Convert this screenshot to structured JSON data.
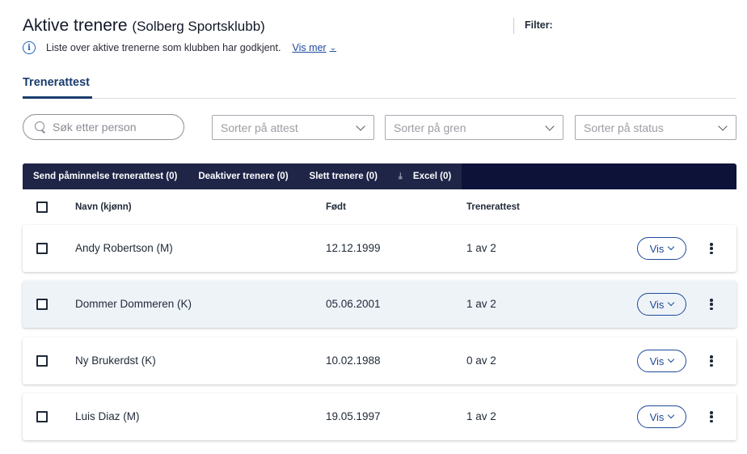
{
  "header": {
    "title": "Aktive trenere",
    "club": "(Solberg Sportsklubb)",
    "info_icon": "info-circle-icon",
    "description": "Liste over aktive trenerne som klubben har godkjent.",
    "vis_mer": "Vis mer",
    "filter_label": "Filter:"
  },
  "tabs": [
    {
      "label": "Trenerattest",
      "active": true
    }
  ],
  "controls": {
    "search_placeholder": "Søk etter person",
    "sort_attest": "Sorter på attest",
    "sort_gren": "Sorter på gren",
    "sort_status": "Sorter på status"
  },
  "actions": {
    "send_reminder": "Send påminnelse trenerattest (0)",
    "deactivate": "Deaktiver trenere (0)",
    "delete": "Slett trenere (0)",
    "excel": "Excel (0)",
    "excel_icon": "download-icon"
  },
  "table": {
    "headers": {
      "name": "Navn (kjønn)",
      "born": "Født",
      "attest": "Trenerattest"
    },
    "view_label": "Vis",
    "rows": [
      {
        "name": "Andy Robertson (M)",
        "born": "12.12.1999",
        "attest": "1 av 2"
      },
      {
        "name": "Dommer Dommeren (K)",
        "born": "05.06.2001",
        "attest": "1 av 2"
      },
      {
        "name": "Ny Brukerdst (K)",
        "born": "10.02.1988",
        "attest": "0 av 2"
      },
      {
        "name": "Luis Diaz (M)",
        "born": "19.05.1997",
        "attest": "1 av 2"
      }
    ]
  },
  "colors": {
    "primary": "#1e4a9a",
    "action_bar": "#0c1238",
    "row_highlight": "#eef3f8"
  }
}
